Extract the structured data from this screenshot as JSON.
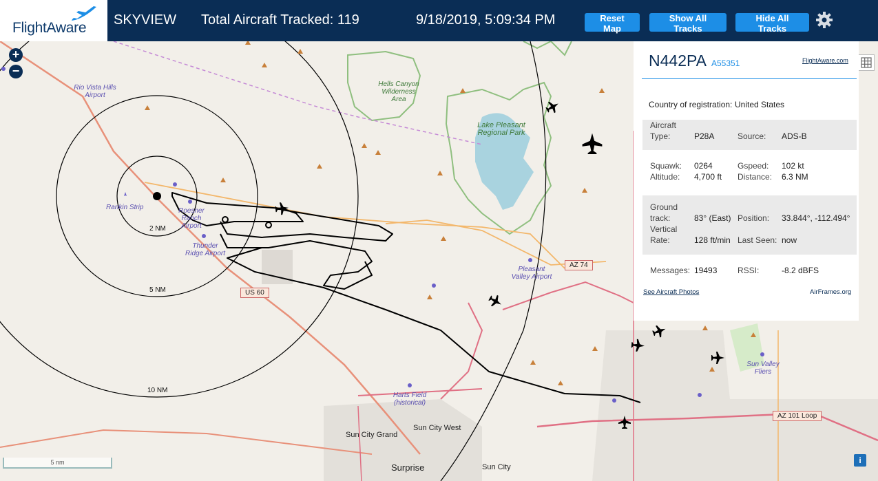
{
  "header": {
    "logo": "FlightAware",
    "app_name": "SKYVIEW",
    "total_tracked": "Total Aircraft Tracked: 119",
    "datetime": "9/18/2019, 5:09:34 PM",
    "buttons": {
      "reset_map": "Reset Map",
      "show_all_tracks": "Show All Tracks",
      "hide_all_tracks": "Hide All Tracks"
    }
  },
  "map": {
    "zoom_in": "+",
    "zoom_out": "−",
    "rings": [
      "2 NM",
      "5 NM",
      "10 NM"
    ],
    "scale_label": "5 nm",
    "info_button": "i",
    "airport_labels": [
      "Rio Vista Hills Airport",
      "Rankin Strip",
      "Roesner Ranch Airport",
      "Thunder Ridge Airport",
      "Pleasant Valley Airport",
      "Harts Field (historical)",
      "Sun Valley Fliers"
    ],
    "park_labels": [
      "Hells Canyon Wilderness Area",
      "Lake Pleasant Regional Park"
    ],
    "towns": [
      "Sun City Grand",
      "Sun City West",
      "Surprise",
      "Sun City"
    ],
    "road_shields": [
      "US 60",
      "AZ 74",
      "AZ 101 Loop"
    ]
  },
  "panel": {
    "registration": "N442PA",
    "hex": "A55351",
    "fa_link": "FlightAware.com",
    "country_label": "Country of registration:",
    "country": "United States",
    "aircraft_type_label": "Aircraft Type:",
    "aircraft_type": "P28A",
    "source_label": "Source:",
    "source": "ADS-B",
    "squawk_label": "Squawk:",
    "squawk": "0264",
    "altitude_label": "Altitude:",
    "altitude": "4,700 ft",
    "gspeed_label": "Gspeed:",
    "gspeed": "102 kt",
    "distance_label": "Distance:",
    "distance": "6.3 NM",
    "ground_track_label": "Ground track:",
    "ground_track": "83° (East)",
    "position_label": "Position:",
    "position": "33.844°, -112.494°",
    "vertical_rate_label": "Vertical Rate:",
    "vertical_rate": "128 ft/min",
    "last_seen_label": "Last Seen:",
    "last_seen": "now",
    "messages_label": "Messages:",
    "messages": "19493",
    "rssi_label": "RSSI:",
    "rssi": "-8.2 dBFS",
    "photos_link": "See Aircraft Photos",
    "airframes_link": "AirFrames.org"
  },
  "colors": {
    "header_bg": "#0a2d55",
    "button_bg": "#1d8ee6",
    "map_bg": "#f2efe9",
    "water": "#a9d3df",
    "park_border": "#8fbf7f"
  }
}
